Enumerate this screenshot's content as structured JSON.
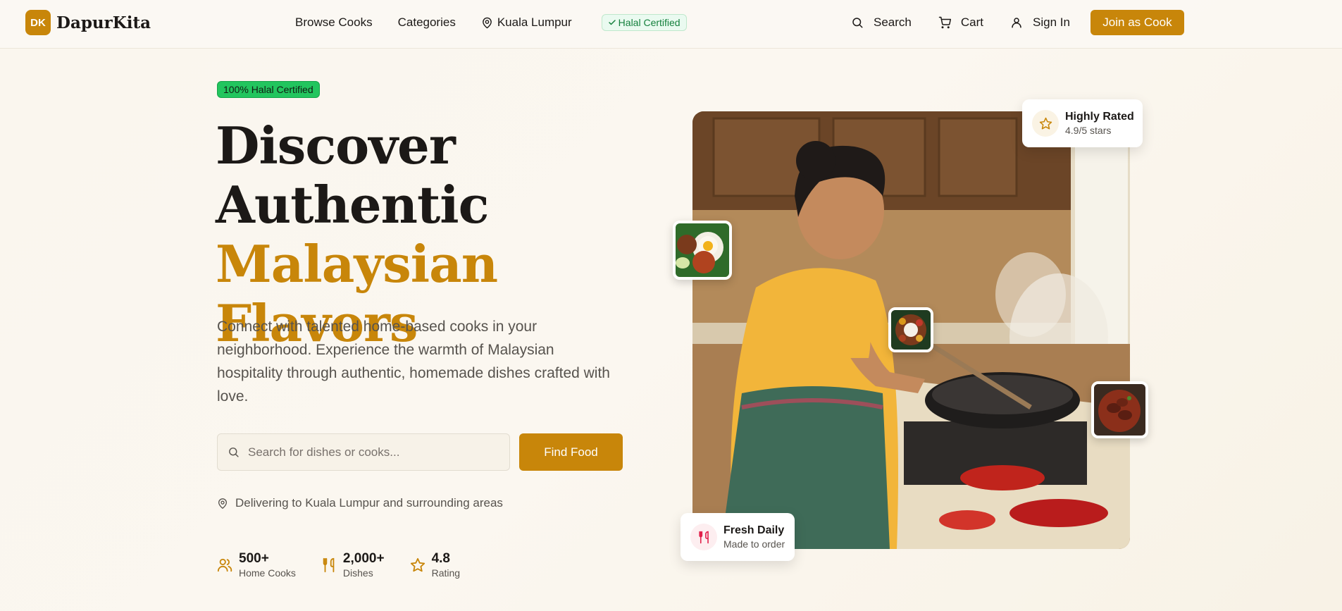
{
  "header": {
    "logo_mark": "DK",
    "logo_text": "DapurKita",
    "nav": {
      "browse": "Browse Cooks",
      "categories": "Categories",
      "location": "Kuala Lumpur",
      "halal": "Halal Certified"
    },
    "actions": {
      "search": "Search",
      "cart": "Cart",
      "sign_in": "Sign In",
      "join": "Join as Cook"
    }
  },
  "hero": {
    "badge": "100% Halal Certified",
    "title_line1": "Discover",
    "title_line2": "Authentic",
    "title_accent": "Malaysian Flavors",
    "description": "Connect with talented home-based cooks in your neighborhood. Experience the warmth of Malaysian hospitality through authentic, homemade dishes crafted with love.",
    "search_placeholder": "Search for dishes or cooks...",
    "search_value": "",
    "find_button": "Find Food",
    "delivery": "Delivering to Kuala Lumpur and surrounding areas",
    "stats": [
      {
        "icon": "users-icon",
        "value": "500+",
        "label": "Home Cooks"
      },
      {
        "icon": "utensils-icon",
        "value": "2,000+",
        "label": "Dishes"
      },
      {
        "icon": "star-icon",
        "value": "4.8",
        "label": "Rating"
      }
    ]
  },
  "image_cards": {
    "rated": {
      "title": "Highly Rated",
      "subtitle": "4.9/5 stars"
    },
    "fresh": {
      "title": "Fresh Daily",
      "subtitle": "Made to order"
    }
  },
  "colors": {
    "brand": "#c8860a",
    "halal_green": "#22c55e",
    "background": "#faf6ee"
  }
}
